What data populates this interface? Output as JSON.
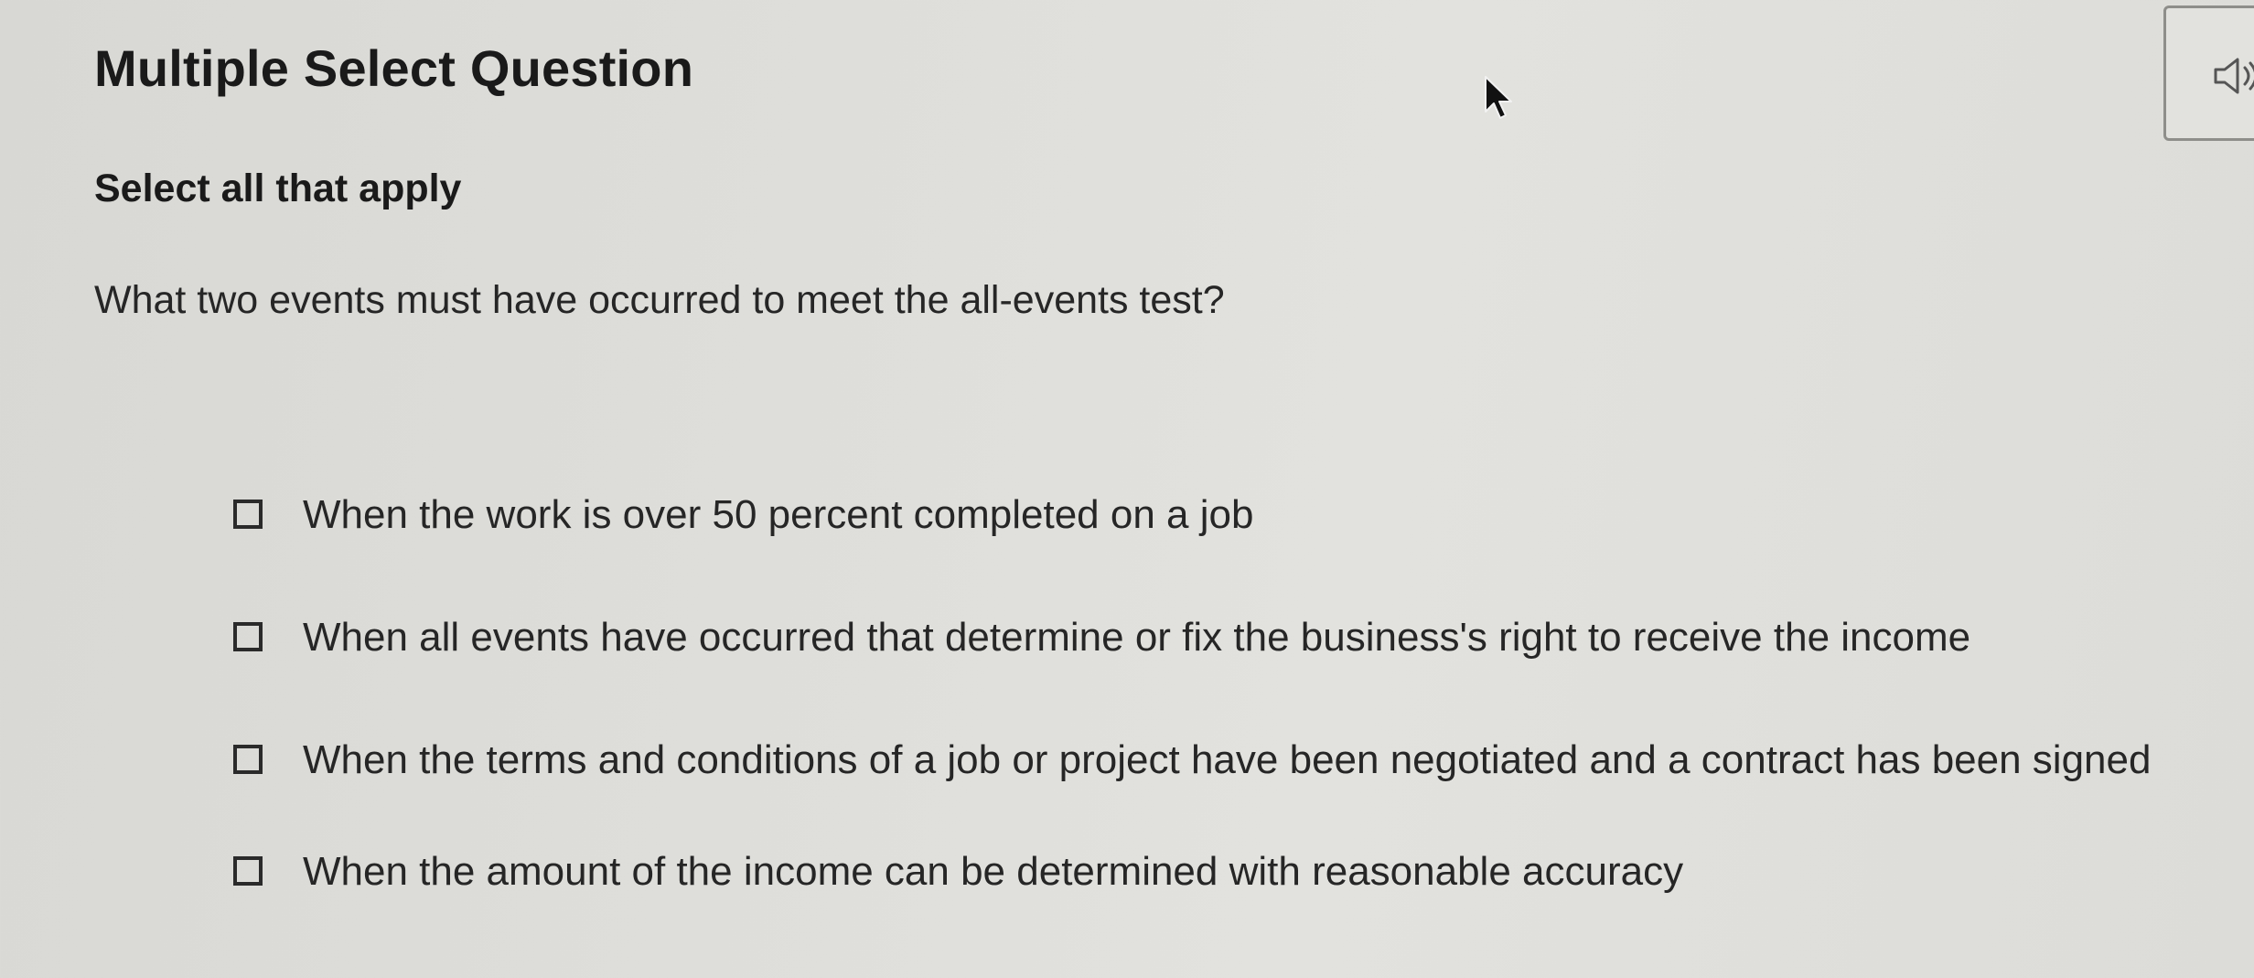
{
  "question": {
    "type_label": "Multiple Select Question",
    "instruction": "Select all that apply",
    "prompt": "What two events must have occurred to meet the all-events test?"
  },
  "audio": {
    "icon": "speaker-icon"
  },
  "options": [
    {
      "label": "When the work is over 50 percent completed on a job",
      "checked": false
    },
    {
      "label": "When all events have occurred that determine or fix the business's right to receive the income",
      "checked": false
    },
    {
      "label": "When the terms and conditions of a job or project have been negotiated and a contract has been signed",
      "checked": false
    },
    {
      "label": "When the amount of the income can be determined with reasonable accuracy",
      "checked": false
    }
  ]
}
